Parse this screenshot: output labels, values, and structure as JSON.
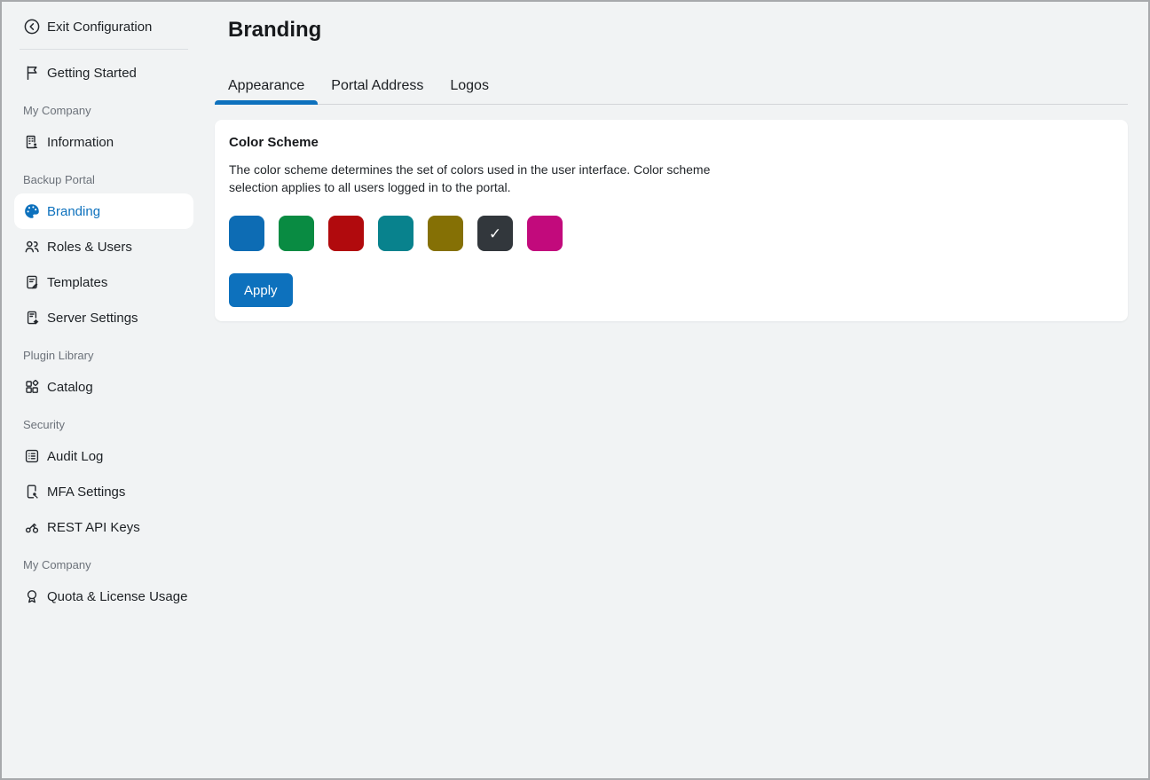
{
  "colors": {
    "brand_blue": "#0d71bd",
    "page_bg": "#f1f3f4",
    "card_bg": "#ffffff",
    "text_dark": "#1d2125",
    "text_muted": "#6c727a",
    "divider": "#dcdfe2",
    "tab_line": "#d2d5d8",
    "frame_border": "#a7a9ac"
  },
  "sidebar": {
    "exit": {
      "label": "Exit Configuration",
      "icon": "chevron-left-circle-icon"
    },
    "getting_started": {
      "label": "Getting Started",
      "icon": "flag-icon"
    },
    "sections": {
      "my_company": "My Company",
      "backup_portal": "Backup Portal",
      "plugin_library": "Plugin Library",
      "security": "Security",
      "my_company_2": "My Company"
    },
    "items": {
      "information": {
        "label": "Information",
        "icon": "company-building-icon"
      },
      "branding": {
        "label": "Branding",
        "icon": "palette-icon",
        "selected": true
      },
      "roles_users": {
        "label": "Roles & Users",
        "icon": "users-icon"
      },
      "templates": {
        "label": "Templates",
        "icon": "clipboard-pencil-icon"
      },
      "server_settings": {
        "label": "Server Settings",
        "icon": "server-gear-icon"
      },
      "catalog": {
        "label": "Catalog",
        "icon": "grid-puzzle-icon"
      },
      "audit_log": {
        "label": "Audit Log",
        "icon": "list-icon"
      },
      "mfa_settings": {
        "label": "MFA Settings",
        "icon": "device-key-icon"
      },
      "rest_api_keys": {
        "label": "REST API Keys",
        "icon": "keys-icon"
      },
      "quota": {
        "label": "Quota & License Usage",
        "icon": "award-ribbon-icon"
      }
    }
  },
  "header": {
    "title": "Branding"
  },
  "tabs": [
    {
      "label": "Appearance",
      "active": true
    },
    {
      "label": "Portal Address",
      "active": false
    },
    {
      "label": "Logos",
      "active": false
    }
  ],
  "card": {
    "title": "Color Scheme",
    "description": "The color scheme determines the set of colors used in the user interface. Color scheme selection applies to all users logged in to the portal.",
    "apply_label": "Apply",
    "swatches": [
      {
        "name": "blue",
        "color": "#0d6cb4",
        "selected": false
      },
      {
        "name": "green",
        "color": "#098b42",
        "selected": false
      },
      {
        "name": "red",
        "color": "#b10a0d",
        "selected": false
      },
      {
        "name": "teal",
        "color": "#08828d",
        "selected": false
      },
      {
        "name": "olive",
        "color": "#857005",
        "selected": false
      },
      {
        "name": "graphite",
        "color": "#32373c",
        "selected": true
      },
      {
        "name": "magenta",
        "color": "#c20a7c",
        "selected": false
      }
    ]
  }
}
